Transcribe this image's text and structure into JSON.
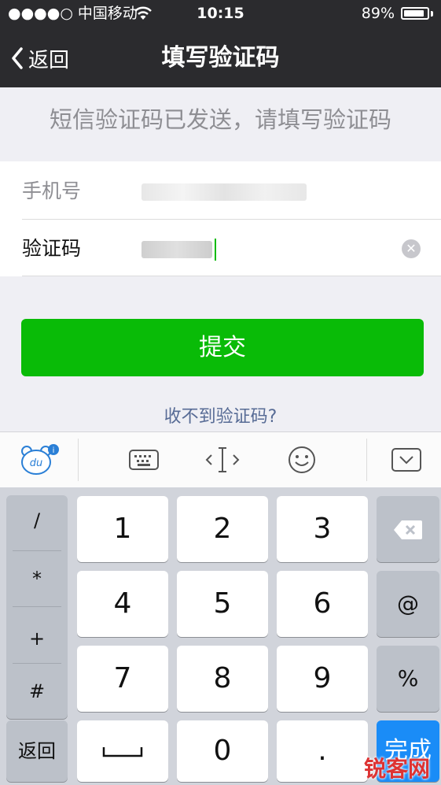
{
  "status": {
    "carrier": "●●●●○ 中国移动",
    "time": "10:15",
    "battery": "89%",
    "battery_level": 0.89
  },
  "nav": {
    "back_label": "返回",
    "title": "填写验证码"
  },
  "hint": "短信验证码已发送，请填写验证码",
  "form": {
    "phone_label": "手机号",
    "code_label": "验证码"
  },
  "submit_label": "提交",
  "no_code_link": "收不到验证码?",
  "keypad": {
    "symbols": [
      "/",
      "*",
      "+",
      "#"
    ],
    "digits": [
      "1",
      "2",
      "3",
      "4",
      "5",
      "6",
      "7",
      "8",
      "9",
      "0"
    ],
    "at": "@",
    "percent": "%",
    "back_key": "返回",
    "dot": ".",
    "done": "完成"
  },
  "watermark": "锐客网",
  "colors": {
    "nav_bg": "#2b2b2e",
    "submit_green": "#09bb07",
    "link_blue": "#576b95",
    "done_blue": "#1a8cf7"
  }
}
